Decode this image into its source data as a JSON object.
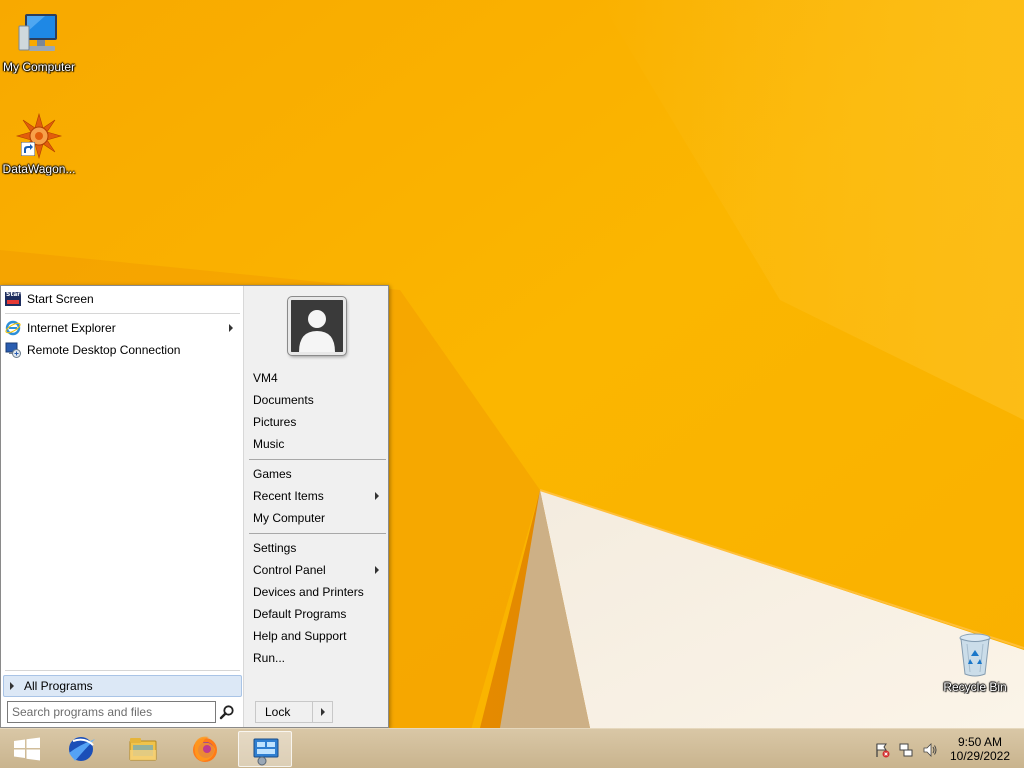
{
  "desktop": {
    "icons": [
      {
        "label": "My Computer",
        "icon": "monitor-icon"
      },
      {
        "label": "DataWagon...",
        "icon": "datawagon-logo-icon"
      },
      {
        "label": "Recycle Bin",
        "icon": "recycle-bin-icon"
      }
    ]
  },
  "start_menu": {
    "programs": [
      {
        "label": "Start Screen",
        "icon": "start-screen-icon"
      },
      {
        "label": "Internet Explorer",
        "icon": "internet-explorer-icon",
        "has_submenu": true
      },
      {
        "label": "Remote Desktop Connection",
        "icon": "remote-desktop-icon"
      }
    ],
    "start_screen_icon_text": "Start",
    "all_programs_label": "All Programs",
    "search": {
      "placeholder": "Search programs and files",
      "value": ""
    },
    "right": {
      "user_name": "VM4",
      "group1": [
        "Documents",
        "Pictures",
        "Music"
      ],
      "group2": [
        {
          "label": "Games"
        },
        {
          "label": "Recent Items",
          "has_submenu": true
        },
        {
          "label": "My Computer"
        }
      ],
      "group3": [
        {
          "label": "Settings"
        },
        {
          "label": "Control Panel",
          "has_submenu": true
        },
        {
          "label": "Devices and Printers"
        },
        {
          "label": "Default Programs"
        },
        {
          "label": "Help and Support"
        },
        {
          "label": "Run..."
        }
      ]
    },
    "lock_label": "Lock"
  },
  "taskbar": {
    "buttons": [
      "windows-start-icon",
      "browser-globe-icon",
      "file-explorer-icon",
      "firefox-icon",
      "control-panel-icon"
    ],
    "tray": [
      "action-center-flag-icon",
      "network-icon",
      "volume-icon"
    ],
    "clock": {
      "time": "9:50 AM",
      "date": "10/29/2022"
    }
  },
  "colors": {
    "wallpaper": "#f7a800",
    "taskbar": "#d2bd98",
    "selection": "#dce8f6"
  }
}
